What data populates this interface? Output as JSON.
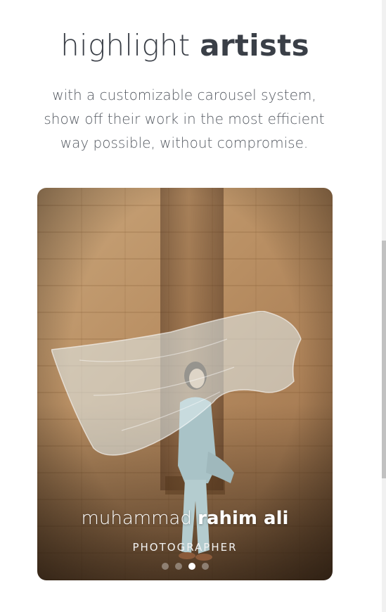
{
  "headline": {
    "light": "highlight",
    "bold": "artists"
  },
  "subtitle": "with a customizable carousel system, show off their work in the most efficient way possible, without compromise.",
  "carousel": {
    "artist_first": "muhammad",
    "artist_last": "rahim ali",
    "role": "PHOTOGRAPHER",
    "slide_count": 4,
    "active_index": 2
  },
  "colors": {
    "heading": "#3a3f47",
    "subtitle": "#555a62",
    "dot_active": "#ffffff"
  }
}
